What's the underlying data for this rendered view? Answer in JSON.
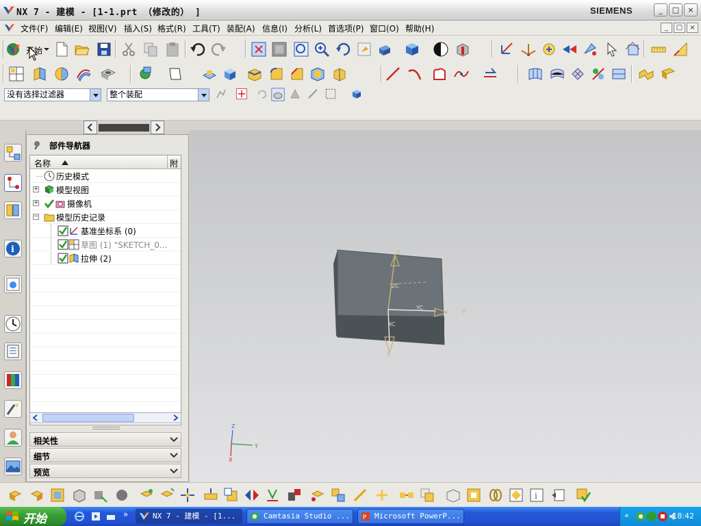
{
  "window": {
    "title": "NX 7 - 建模 - [1-1.prt （修改的） ]",
    "brand": "SIEMENS",
    "controls": [
      "_",
      "□",
      "×"
    ]
  },
  "menubar": {
    "items": [
      "文件(F)",
      "编辑(E)",
      "视图(V)",
      "插入(S)",
      "格式(R)",
      "工具(T)",
      "装配(A)",
      "信息(I)",
      "分析(L)",
      "首选项(P)",
      "窗口(O)",
      "帮助(H)"
    ],
    "mdi_controls": [
      "_",
      "□",
      "×"
    ]
  },
  "toolbar": {
    "start_label": "开始",
    "selection_filter": "没有选择过滤器",
    "assembly_scope": "整个装配"
  },
  "navigator": {
    "title": "部件导航器",
    "columns": [
      "名称",
      "附"
    ],
    "tree": [
      {
        "label": "历史模式",
        "icon": "clock-icon",
        "expander": ""
      },
      {
        "label": "模型视图",
        "icon": "model-views-icon",
        "expander": "+"
      },
      {
        "label": "摄像机",
        "icon": "camera-icon",
        "expander": "+"
      },
      {
        "label": "模型历史记录",
        "icon": "folder-icon",
        "expander": "−"
      },
      {
        "label": "基准坐标系 (0)",
        "icon": "datum-csys-icon",
        "expander": ""
      },
      {
        "label": "草图 (1) \"SKETCH_0...",
        "icon": "sketch-icon",
        "expander": ""
      },
      {
        "label": "拉伸 (2)",
        "icon": "extrude-icon",
        "expander": ""
      }
    ],
    "sections": [
      "相关性",
      "细节",
      "预览"
    ]
  },
  "viewport": {
    "csys_labels": {
      "z": "Z",
      "zc": "ZC",
      "xc": "XC",
      "yc": "YC",
      "y": "Y",
      "x": "X"
    },
    "triad_labels": {
      "z": "Z",
      "y": "Y",
      "x": "X"
    }
  },
  "taskbar": {
    "start_label": "开始",
    "tasks": [
      "NX 7 - 建模 - [1...",
      "Camtasia Studio ...",
      "Microsoft PowerP..."
    ],
    "clock": "18:42"
  },
  "colors": {
    "taskbar_blue": "#2251d1",
    "start_green": "#38a135",
    "viewport_grey": "#d0d1d3",
    "block_grey": "#6a7276"
  }
}
